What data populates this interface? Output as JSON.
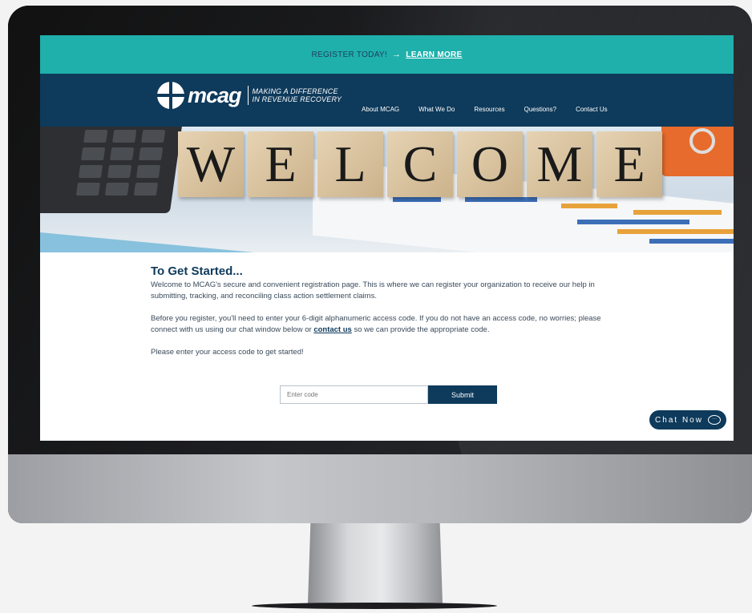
{
  "banner": {
    "text": "REGISTER TODAY!",
    "arrow": "→",
    "link": "LEARN MORE"
  },
  "logo": {
    "word": "mcag",
    "tagline_line1": "MAKING A DIFFERENCE",
    "tagline_line2": "IN REVENUE RECOVERY"
  },
  "nav": {
    "items": [
      "About MCAG",
      "What We Do",
      "Resources",
      "Questions?",
      "Contact Us"
    ]
  },
  "hero": {
    "letters": [
      "W",
      "E",
      "L",
      "C",
      "O",
      "M",
      "E"
    ]
  },
  "content": {
    "title": "To Get Started...",
    "para1": "Welcome to MCAG's secure and convenient registration page. This is where we can register your organization to receive our help in submitting, tracking, and reconciling class action settlement claims.",
    "para2_before": "Before you register, you'll need to enter your 6-digit alphanumeric access code. If you do not have an access code, no worries; please connect with us using our chat window below or ",
    "para2_link": "contact us",
    "para2_after": " so we can provide the appropriate code.",
    "para3": "Please enter your access code to get started!"
  },
  "form": {
    "placeholder": "Enter code",
    "submit_label": "Submit"
  },
  "chat": {
    "label": "Chat Now",
    "icon": "chat-bubble-icon"
  },
  "colors": {
    "teal": "#1fb0ab",
    "navy": "#0e3a5b"
  }
}
